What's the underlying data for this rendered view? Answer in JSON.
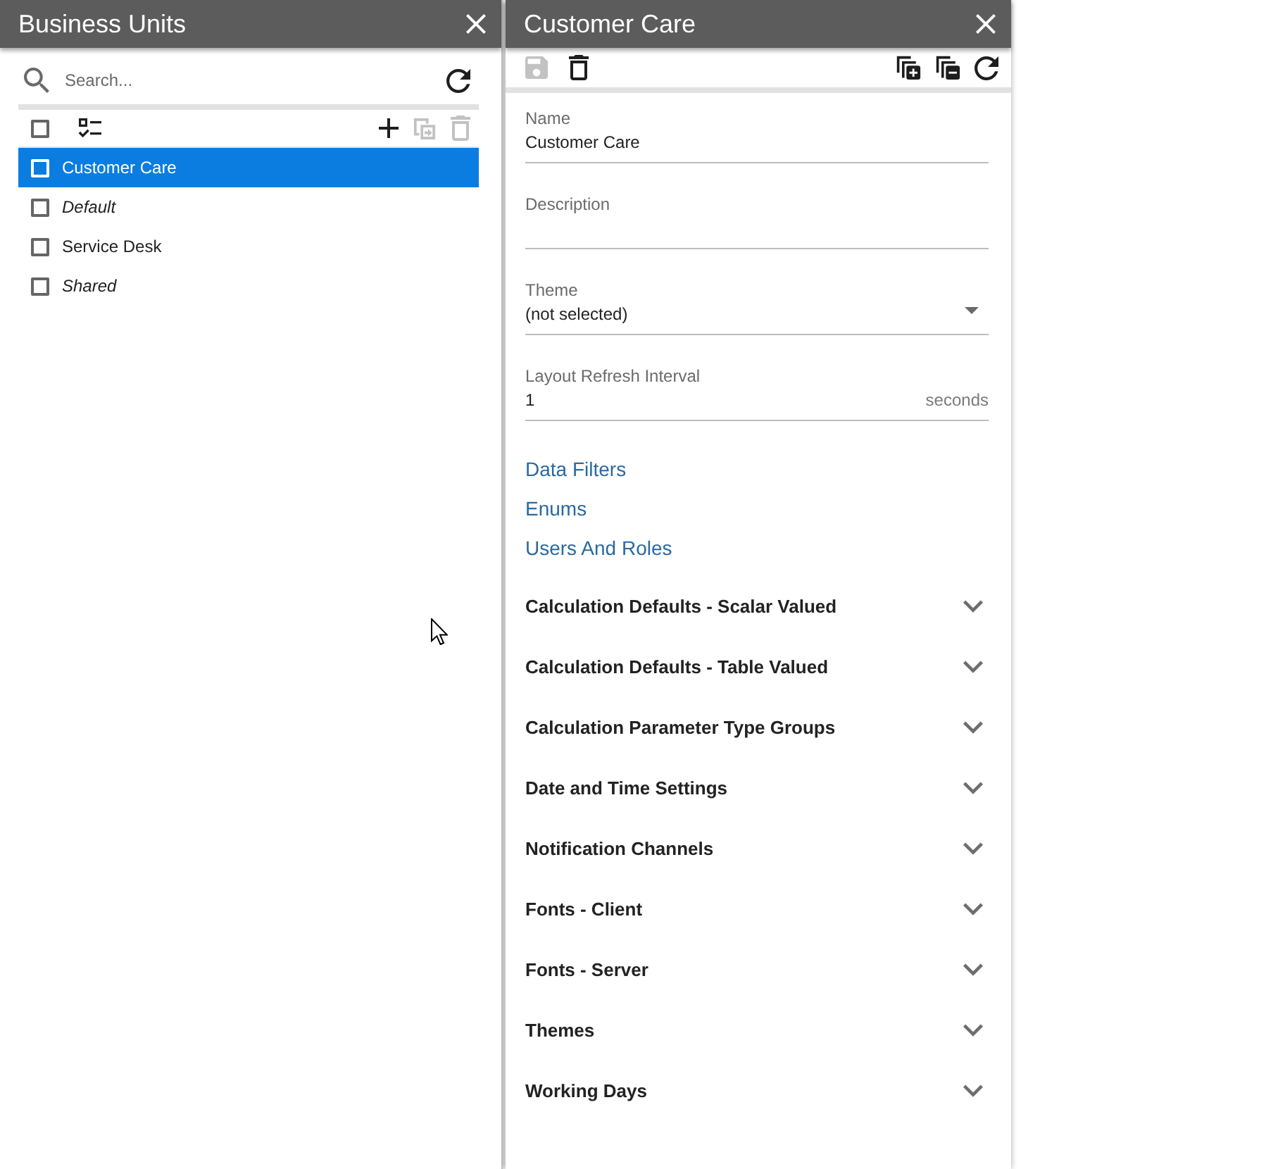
{
  "business_units": {
    "title": "Business Units",
    "search": {
      "placeholder": "Search..."
    },
    "select_all": {
      "checked": false
    },
    "toolbar": [
      {
        "kind": "add",
        "disabled": false
      },
      {
        "kind": "copy",
        "disabled": true
      },
      {
        "kind": "delete",
        "disabled": true
      }
    ],
    "items": [
      {
        "label": "Customer Care",
        "selected": true,
        "checked": false,
        "italic": false
      },
      {
        "label": "Default",
        "selected": false,
        "checked": false,
        "italic": true
      },
      {
        "label": "Service Desk",
        "selected": false,
        "checked": false,
        "italic": false
      },
      {
        "label": "Shared",
        "selected": false,
        "checked": false,
        "italic": true
      }
    ]
  },
  "detail": {
    "title": "Customer Care",
    "toolbar_left": [
      {
        "kind": "save",
        "disabled": true
      },
      {
        "kind": "delete",
        "disabled": false
      }
    ],
    "toolbar_right": [
      {
        "kind": "expand_all",
        "disabled": false
      },
      {
        "kind": "collapse_all",
        "disabled": false
      },
      {
        "kind": "reload",
        "disabled": false
      }
    ],
    "fields": [
      {
        "kind": "text",
        "label": "Name",
        "value": "Customer Care"
      },
      {
        "kind": "text",
        "label": "Description"
      },
      {
        "kind": "select",
        "label": "Theme",
        "value": "(not selected)"
      },
      {
        "kind": "number",
        "label": "Layout Refresh Interval",
        "value": "1",
        "unit": "seconds"
      }
    ],
    "links": [
      "Data Filters",
      "Enums",
      "Users And Roles"
    ],
    "sections": [
      {
        "title": "Calculation Defaults - Scalar Valued",
        "expanded": false
      },
      {
        "title": "Calculation Defaults - Table Valued",
        "expanded": false
      },
      {
        "title": "Calculation Parameter Type Groups",
        "expanded": false
      },
      {
        "title": "Date and Time Settings",
        "expanded": false
      },
      {
        "title": "Notification Channels",
        "expanded": false
      },
      {
        "title": "Fonts - Client",
        "expanded": false
      },
      {
        "title": "Fonts - Server",
        "expanded": false
      },
      {
        "title": "Themes",
        "expanded": false
      },
      {
        "title": "Working Days",
        "expanded": false
      }
    ]
  }
}
